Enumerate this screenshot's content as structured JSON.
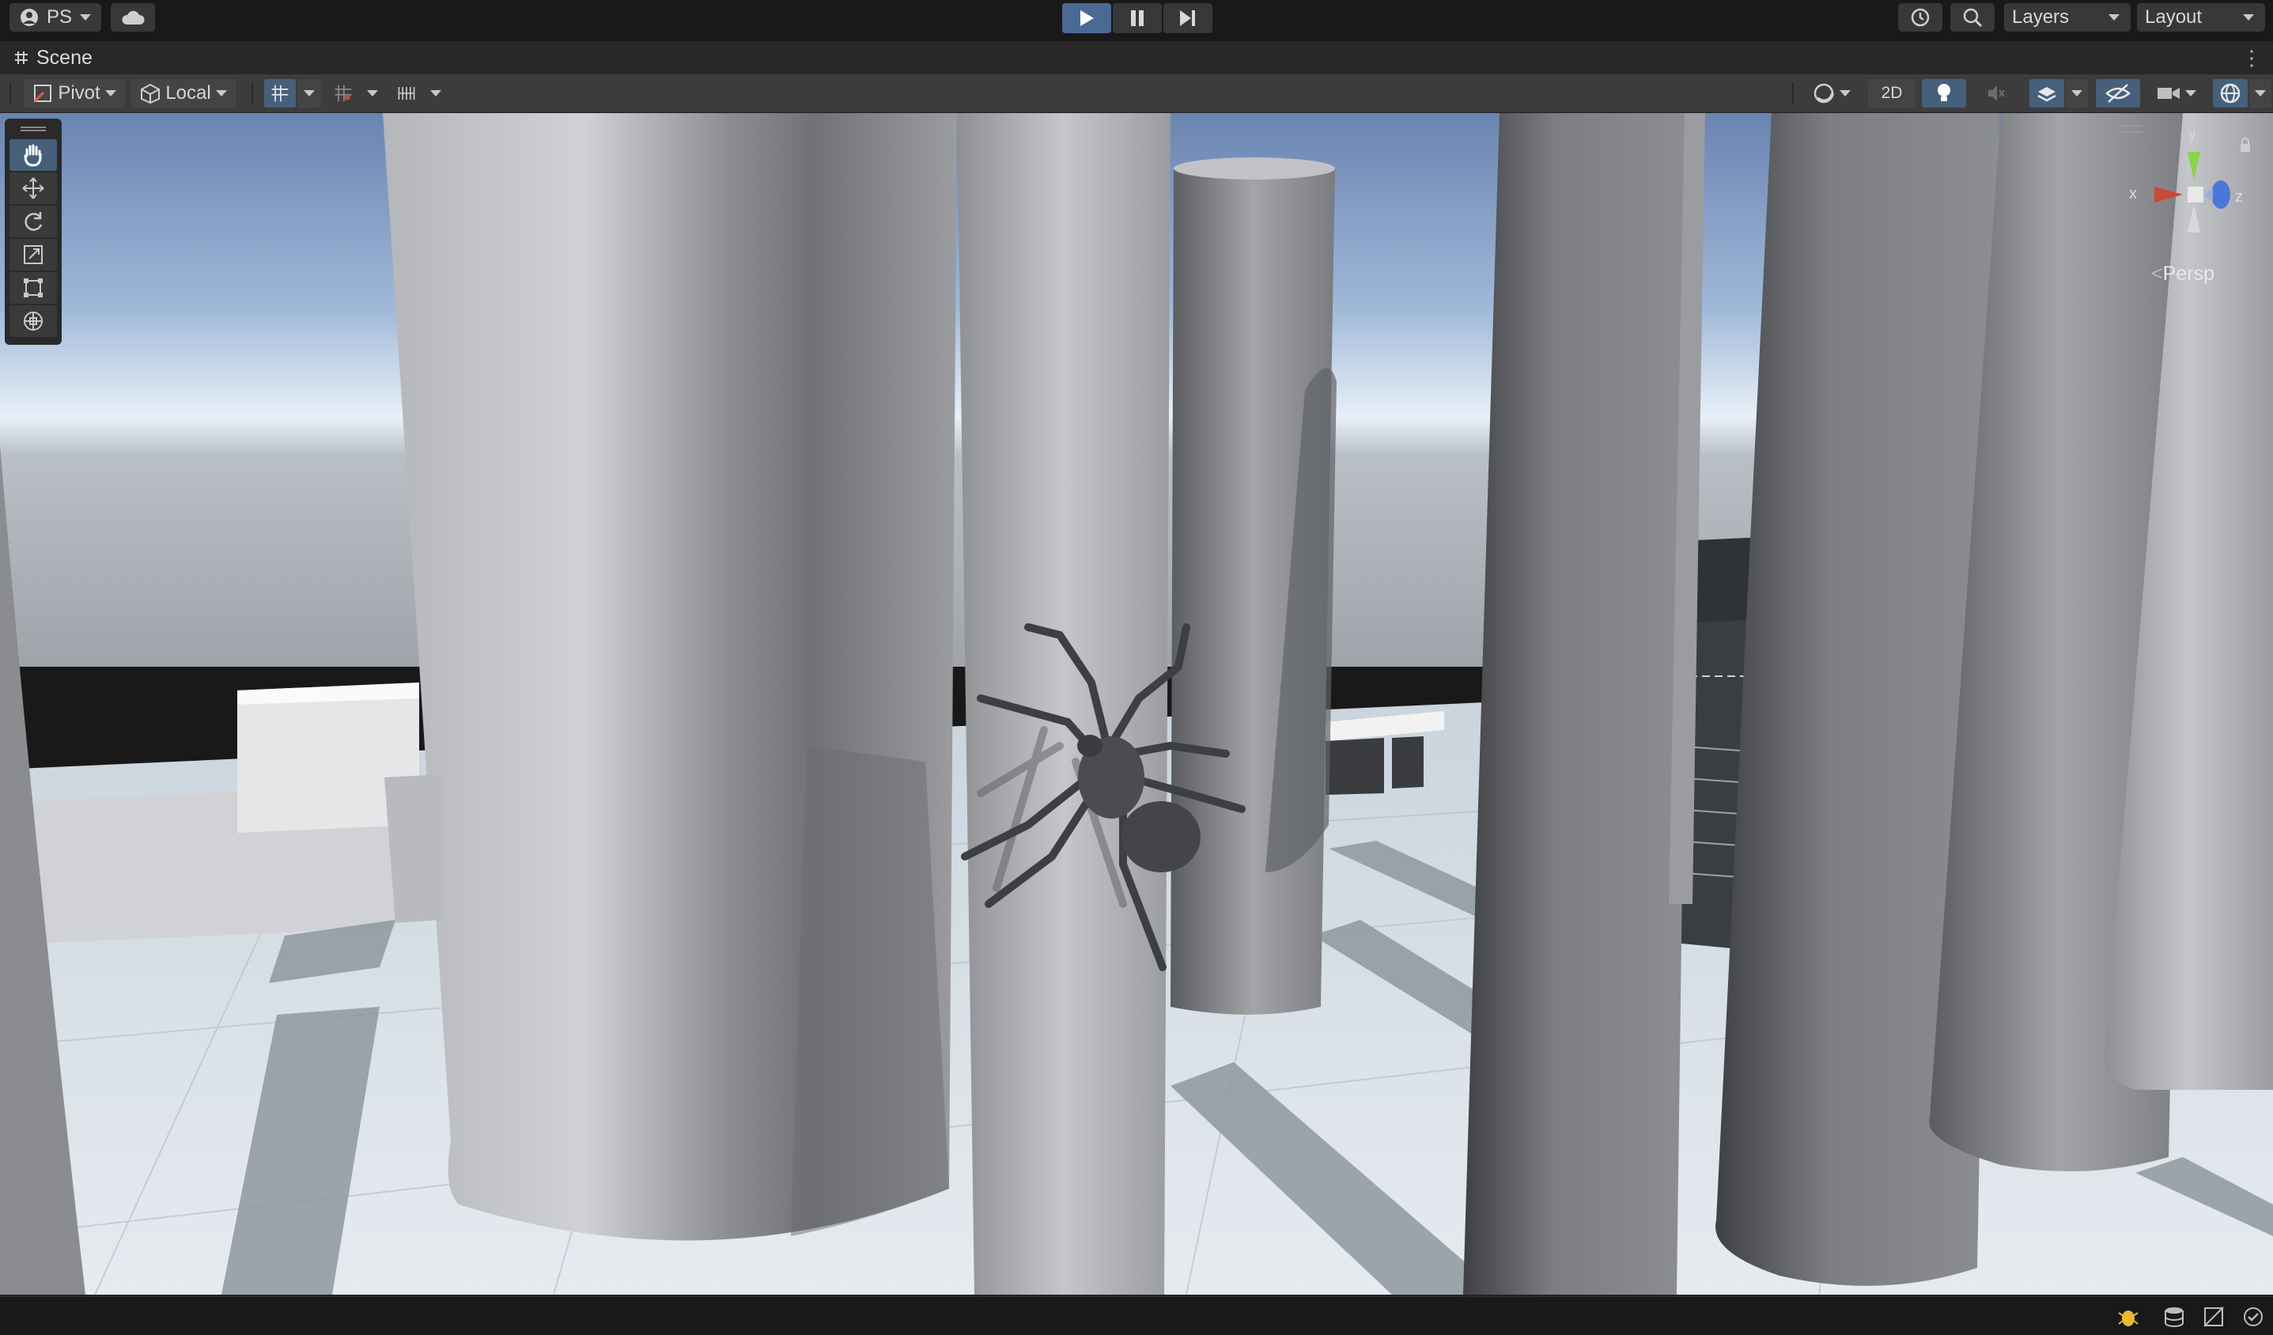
{
  "toolbar": {
    "account_label": "PS",
    "layers_label": "Layers",
    "layout_label": "Layout",
    "icons": [
      "account-icon",
      "cloud-icon",
      "play-icon",
      "pause-icon",
      "step-icon",
      "history-icon",
      "search-icon"
    ]
  },
  "scene": {
    "tab_label": "Scene"
  },
  "scene_toolbar": {
    "pivot_label": "Pivot",
    "local_label": "Local",
    "mode_2d_label": "2D"
  },
  "viewport": {
    "persp_label": "Persp",
    "axis_x": "x",
    "axis_y": "y",
    "axis_z": "z",
    "tools": [
      "hand-tool",
      "move-tool",
      "rotate-tool",
      "scale-tool",
      "rect-tool",
      "transform-tool"
    ],
    "active_tool": "hand-tool"
  },
  "colors": {
    "accent": "#46607c",
    "play_active": "#4a6a94",
    "axis_x": "#c84a3a",
    "axis_y": "#8ad24a",
    "axis_z": "#4a78d8"
  }
}
